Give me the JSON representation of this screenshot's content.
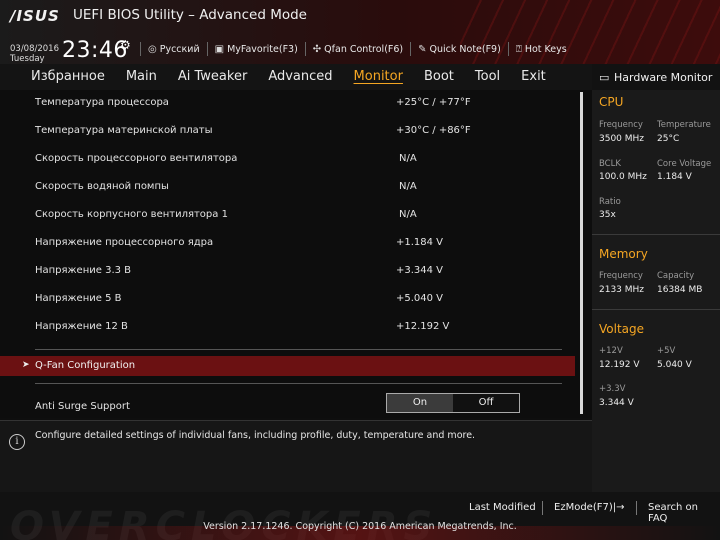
{
  "header": {
    "logo": "/ISUS",
    "title": "UEFI BIOS Utility – Advanced Mode",
    "date": "03/08/2016",
    "day": "Tuesday",
    "time": "23:46",
    "toolbar": [
      {
        "icon": "globe-icon",
        "label": "Русский"
      },
      {
        "icon": "myfavorite-icon",
        "label": "MyFavorite(F3)"
      },
      {
        "icon": "fan-icon",
        "label": "Qfan Control(F6)"
      },
      {
        "icon": "note-icon",
        "label": "Quick Note(F9)"
      },
      {
        "icon": "help-icon",
        "label": "Hot Keys"
      }
    ]
  },
  "menu": [
    "Избранное",
    "Main",
    "Ai Tweaker",
    "Advanced",
    "Monitor",
    "Boot",
    "Tool",
    "Exit"
  ],
  "menu_active": "Monitor",
  "monitor": {
    "rows": [
      {
        "label": "Температура процессора",
        "value": "+25°C / +77°F"
      },
      {
        "label": "Температура материнской платы",
        "value": "+30°C / +86°F"
      },
      {
        "label": "Скорость процессорного вентилятора",
        "value": "N/A"
      },
      {
        "label": "Скорость водяной помпы",
        "value": "N/A"
      },
      {
        "label": "Скорость корпусного вентилятора 1",
        "value": "N/A"
      },
      {
        "label": "Напряжение процессорного ядра",
        "value": "+1.184 V"
      },
      {
        "label": "Напряжение 3.3 В",
        "value": "+3.344 V"
      },
      {
        "label": "Напряжение 5 В",
        "value": "+5.040 V"
      },
      {
        "label": "Напряжение 12 В",
        "value": "+12.192 V"
      }
    ],
    "qfan_label": "Q-Fan Configuration",
    "anti_surge_label": "Anti Surge Support",
    "toggle_on": "On",
    "toggle_off": "Off",
    "toggle_selected": "On"
  },
  "help_text": "Configure detailed settings of individual fans, including profile, duty, temperature and more.",
  "hardware_monitor": {
    "title": "Hardware Monitor",
    "cpu": {
      "heading": "CPU",
      "frequency_label": "Frequency",
      "frequency": "3500 MHz",
      "temperature_label": "Temperature",
      "temperature": "25°C",
      "bclk_label": "BCLK",
      "bclk": "100.0 MHz",
      "core_voltage_label": "Core Voltage",
      "core_voltage": "1.184 V",
      "ratio_label": "Ratio",
      "ratio": "35x"
    },
    "memory": {
      "heading": "Memory",
      "frequency_label": "Frequency",
      "frequency": "2133 MHz",
      "capacity_label": "Capacity",
      "capacity": "16384 MB"
    },
    "voltage": {
      "heading": "Voltage",
      "v12_label": "+12V",
      "v12": "12.192 V",
      "v5_label": "+5V",
      "v5": "5.040 V",
      "v33_label": "+3.3V",
      "v33": "3.344 V"
    }
  },
  "footer": {
    "last_modified": "Last Modified",
    "ezmode": "EzMode(F7)|",
    "search_faq": "Search on FAQ",
    "copyright": "Version 2.17.1246. Copyright (C) 2016 American Megatrends, Inc.",
    "watermark": "OVERCLOCKERS"
  },
  "colors": {
    "accent": "#f5a623",
    "highlight_row": "#6b1112"
  }
}
